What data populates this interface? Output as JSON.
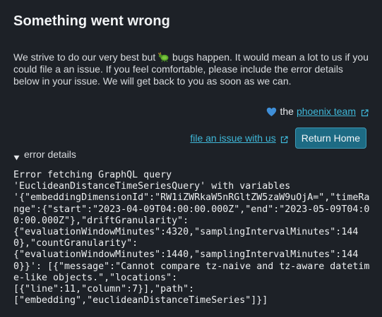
{
  "page": {
    "title": "Something went wrong",
    "message_before": "We strive to do our very best but ",
    "bug_emoji_icon": "bug-icon",
    "message_after": " bugs happen. It would mean a lot to us if you could file a an issue. If you feel comfortable, please include the error details below in your issue. We will get back to you as soon as we can."
  },
  "team_line": {
    "heart_icon": "blue-heart-icon",
    "prefix": "the",
    "link_text": "phoenix team"
  },
  "actions": {
    "issue_link_text": "file an issue with us",
    "return_button_label": "Return Home"
  },
  "error_details": {
    "toggle_label": "error details",
    "toggle_icon": "triangle-down-icon",
    "text": "Error fetching GraphQL query\n'EuclideanDistanceTimeSeriesQuery' with variables\n'{\"embeddingDimensionId\":\"RW1iZWRkaW5nRGltZW5zaW9uOjA=\",\"timeRange\":{\"start\":\"2023-04-09T04:00:00.000Z\",\"end\":\"2023-05-09T04:00:00.000Z\"},\"driftGranularity\":\n{\"evaluationWindowMinutes\":4320,\"samplingIntervalMinutes\":1440},\"countGranularity\":\n{\"evaluationWindowMinutes\":1440,\"samplingIntervalMinutes\":1440}}': [{\"message\":\"Cannot compare tz-naive and tz-aware datetime-like objects.\",\"locations\":\n[{\"line\":11,\"column\":7}],\"path\":\n[\"embedding\",\"euclideanDistanceTimeSeries\"]}]"
  },
  "colors": {
    "background": "#1d2127",
    "link": "#3fb8d9",
    "button_bg": "#1d6b84",
    "button_border": "#3e98b4",
    "heart": "#3f8fd8",
    "bug": "#5aa82b"
  }
}
